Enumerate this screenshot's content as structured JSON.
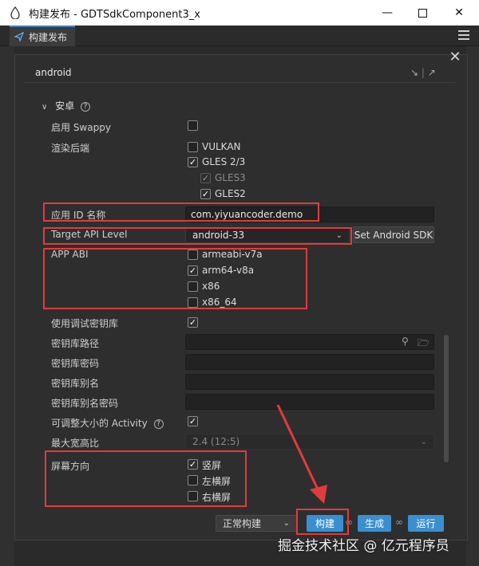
{
  "window": {
    "title": "构建发布 - GDTSdkComponent3_x"
  },
  "tab": {
    "label": "构建发布"
  },
  "header": {
    "platform": "android"
  },
  "section": {
    "title": "安卓",
    "help": "?"
  },
  "rows": {
    "swappy": "启用 Swappy",
    "render_backend": "渲染后端",
    "vulkan": "VULKAN",
    "gles23": "GLES 2/3",
    "gles3": "GLES3",
    "gles2": "GLES2",
    "app_id_label": "应用 ID 名称",
    "app_id_value": "com.yiyuancoder.demo",
    "target_api_label": "Target API Level",
    "target_api_value": "android-33",
    "set_sdk": "Set Android SDK",
    "app_abi_label": "APP ABI",
    "abi_armv7": "armeabi-v7a",
    "abi_arm64": "arm64-v8a",
    "abi_x86": "x86",
    "abi_x86_64": "x86_64",
    "debug_keystore": "使用调试密钥库",
    "keystore_path": "密钥库路径",
    "keystore_pwd": "密钥库密码",
    "keystore_alias": "密钥库别名",
    "keystore_alias_pwd": "密钥库别名密码",
    "resizable_activity": "可调整大小的 Activity",
    "max_aspect": "最大宽高比",
    "max_aspect_value": "2.4 (12:5)",
    "orientation": "屏幕方向",
    "portrait": "竖屏",
    "landscape_left": "左横屏",
    "landscape_right": "右横屏"
  },
  "footer": {
    "mode": "正常构建",
    "build": "构建",
    "make": "生成",
    "run": "运行"
  },
  "watermark": "掘金技术社区 @ 亿元程序员",
  "colors": {
    "accent": "#3a8fd0",
    "highlight": "#e23b3b"
  }
}
